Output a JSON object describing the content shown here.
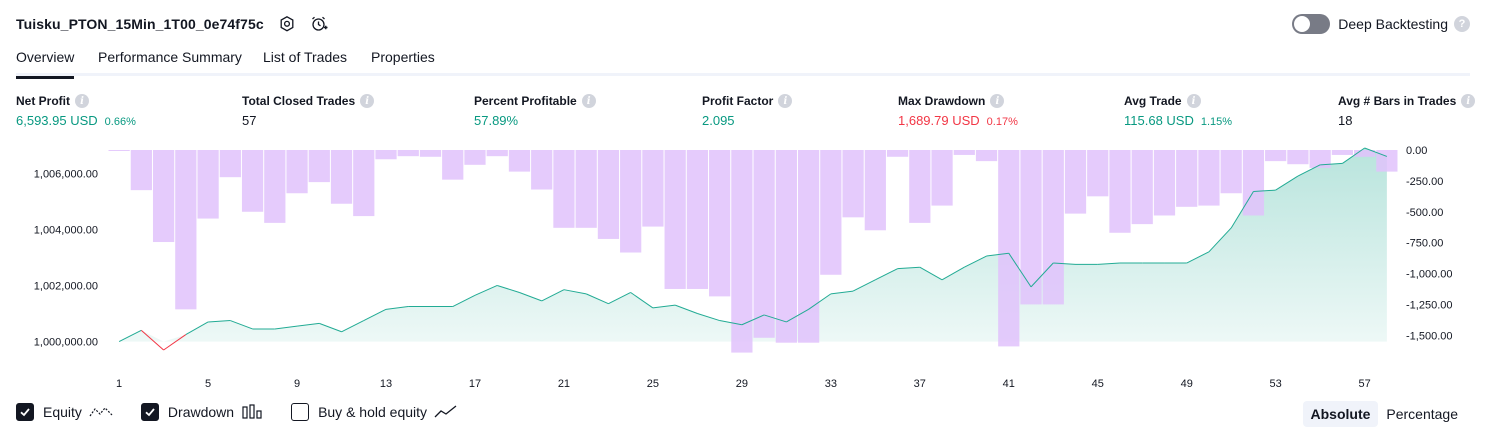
{
  "header": {
    "strategy_name": "Tuisku_PTON_15Min_1T00_0e74f75c",
    "deep_backtesting_label": "Deep Backtesting",
    "deep_backtesting_enabled": false
  },
  "tabs": [
    {
      "label": "Overview",
      "active": true
    },
    {
      "label": "Performance Summary",
      "active": false
    },
    {
      "label": "List of Trades",
      "active": false
    },
    {
      "label": "Properties",
      "active": false
    }
  ],
  "metrics": [
    {
      "label": "Net Profit",
      "value": "6,593.95 USD",
      "pct": "0.66%",
      "color": "green"
    },
    {
      "label": "Total Closed Trades",
      "value": "57",
      "pct": "",
      "color": "dark"
    },
    {
      "label": "Percent Profitable",
      "value": "57.89%",
      "pct": "",
      "color": "green"
    },
    {
      "label": "Profit Factor",
      "value": "2.095",
      "pct": "",
      "color": "green"
    },
    {
      "label": "Max Drawdown",
      "value": "1,689.79 USD",
      "pct": "0.17%",
      "color": "red"
    },
    {
      "label": "Avg Trade",
      "value": "115.68 USD",
      "pct": "1.15%",
      "color": "green"
    },
    {
      "label": "Avg # Bars in Trades",
      "value": "18",
      "pct": "",
      "color": "dark"
    }
  ],
  "colors": {
    "equity_line": "#22ab94",
    "equity_fill": "#d7f0e9",
    "equity_negative": "#f23645",
    "drawdown_bar": "#e1c2fc",
    "drawdown_overlap": "#b9a3d9",
    "green": "#089981",
    "red": "#f23645"
  },
  "chart_data": {
    "type": "bar+area",
    "x_tick_labels": [
      "1",
      "5",
      "9",
      "13",
      "17",
      "21",
      "25",
      "29",
      "33",
      "37",
      "41",
      "45",
      "49",
      "53",
      "57"
    ],
    "x_ticks": [
      1,
      5,
      9,
      13,
      17,
      21,
      25,
      29,
      33,
      37,
      41,
      45,
      49,
      53,
      57
    ],
    "left_axis": {
      "ticks": [
        1000000,
        1002000,
        1004000,
        1006000
      ],
      "tick_labels": [
        "1,000,000.00",
        "1,002,000.00",
        "1,004,000.00",
        "1,006,000.00"
      ],
      "ylim": [
        999700,
        1006900
      ]
    },
    "right_axis": {
      "ticks": [
        0,
        -250,
        -500,
        -750,
        -1000,
        -1250,
        -1500
      ],
      "tick_labels": [
        "0.00",
        "-250.00",
        "-500.00",
        "-750.00",
        "-1,000.00",
        "-1,250.00",
        "-1,500.00"
      ],
      "ylim": [
        -1700,
        0
      ]
    },
    "series": [
      {
        "name": "Equity",
        "trade_numbers": [
          1,
          2,
          3,
          4,
          5,
          6,
          7,
          8,
          9,
          10,
          11,
          12,
          13,
          14,
          15,
          16,
          17,
          18,
          19,
          20,
          21,
          22,
          23,
          24,
          25,
          26,
          27,
          28,
          29,
          30,
          31,
          32,
          33,
          34,
          35,
          36,
          37,
          38,
          39,
          40,
          41,
          42,
          43,
          44,
          45,
          46,
          47,
          48,
          49,
          50,
          51,
          52,
          53,
          54,
          55,
          56,
          57,
          58
        ],
        "values": [
          1000000,
          1000400,
          999700,
          1000250,
          1000700,
          1000750,
          1000450,
          1000450,
          1000550,
          1000650,
          1000350,
          1000750,
          1001150,
          1001250,
          1001250,
          1001250,
          1001650,
          1002000,
          1001750,
          1001450,
          1001850,
          1001700,
          1001350,
          1001750,
          1001200,
          1001300,
          1001000,
          1000750,
          1000600,
          1000950,
          1000700,
          1001150,
          1001700,
          1001800,
          1002200,
          1002600,
          1002650,
          1002200,
          1002650,
          1003050,
          1003150,
          1001950,
          1002800,
          1002750,
          1002750,
          1002800,
          1002800,
          1002800,
          1002800,
          1003200,
          1004050,
          1005350,
          1005400,
          1005900,
          1006300,
          1006350,
          1006900,
          1006600
        ]
      },
      {
        "name": "Drawdown",
        "trade_numbers": [
          1,
          2,
          3,
          4,
          5,
          6,
          7,
          8,
          9,
          10,
          11,
          12,
          13,
          14,
          15,
          16,
          17,
          18,
          19,
          20,
          21,
          22,
          23,
          24,
          25,
          26,
          27,
          28,
          29,
          30,
          31,
          32,
          33,
          34,
          35,
          36,
          37,
          38,
          39,
          40,
          41,
          42,
          43,
          44,
          45,
          46,
          47,
          48,
          49,
          50,
          51,
          52,
          53,
          54,
          55,
          56,
          57,
          58
        ],
        "values": [
          -5,
          -325,
          -745,
          -1290,
          -555,
          -220,
          -500,
          -590,
          -350,
          -260,
          -435,
          -535,
          -75,
          -50,
          -55,
          -240,
          -120,
          -50,
          -175,
          -320,
          -630,
          -630,
          -720,
          -830,
          -620,
          -1125,
          -1125,
          -1185,
          -1640,
          -1520,
          -1560,
          -1560,
          -1010,
          -545,
          -650,
          -55,
          -590,
          -450,
          -40,
          -90,
          -1590,
          -1250,
          -1250,
          -515,
          -375,
          -670,
          -600,
          -530,
          -460,
          -450,
          -350,
          -530,
          -90,
          -115,
          -145,
          -40,
          -55,
          -175
        ]
      }
    ],
    "legend": [
      "Equity",
      "Drawdown",
      "Buy & hold equity"
    ]
  },
  "legend": {
    "items": [
      {
        "label": "Equity",
        "checked": true,
        "icon": "equity-line-icon"
      },
      {
        "label": "Drawdown",
        "checked": true,
        "icon": "drawdown-bars-icon"
      },
      {
        "label": "Buy & hold equity",
        "checked": false,
        "icon": "buy-hold-line-icon"
      }
    ]
  },
  "mode": {
    "options": [
      "Absolute",
      "Percentage"
    ],
    "selected": "Absolute"
  }
}
